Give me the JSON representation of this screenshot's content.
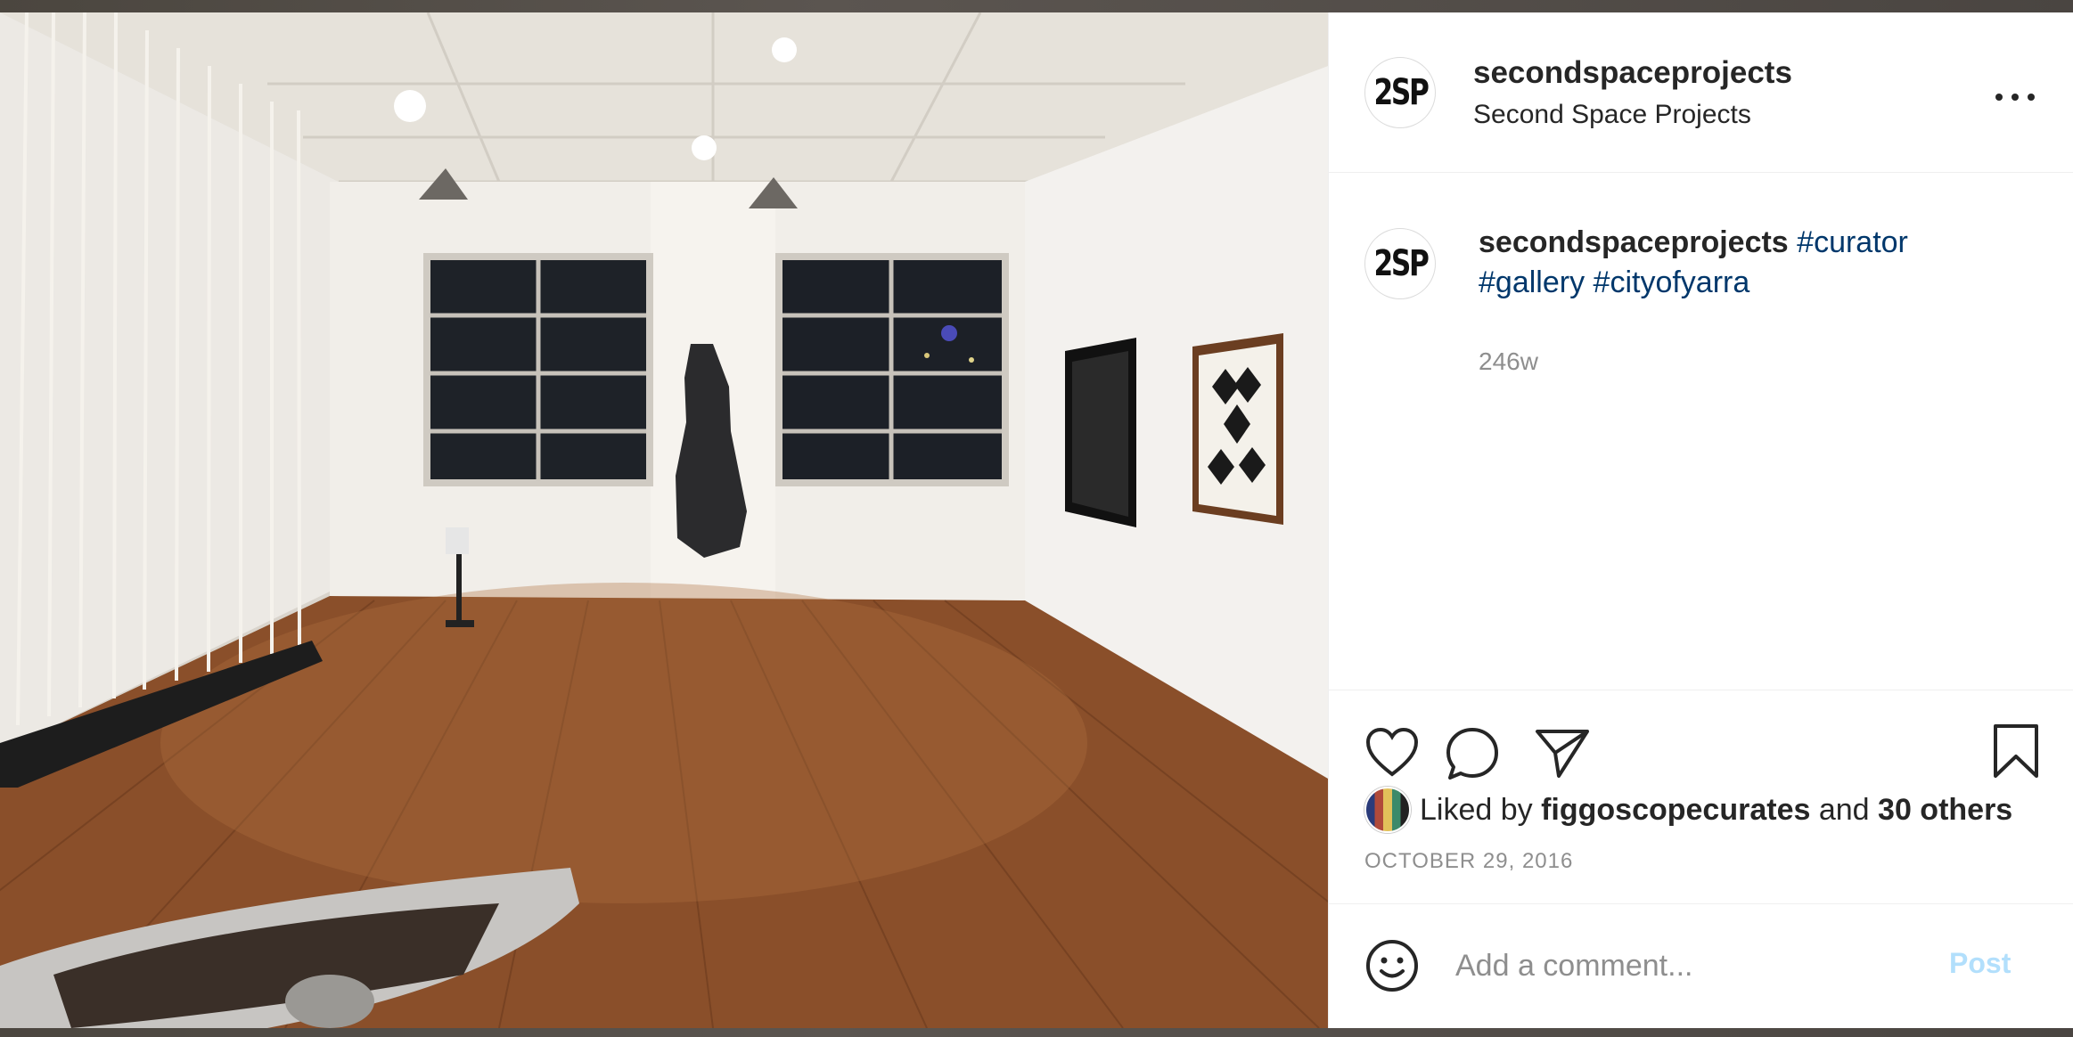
{
  "post": {
    "username": "secondspaceprojects",
    "full_name": "Second Space Projects",
    "avatar_text": "2SP",
    "more_icon": "more-horizontal-icon",
    "caption": {
      "username": "secondspaceprojects",
      "hashtags": [
        "#curator",
        "#gallery",
        "#cityofyarra"
      ]
    },
    "age": "246w",
    "likes": {
      "prefix": "Liked by",
      "user": "figgoscopecurates",
      "joiner": "and",
      "others": "30 others"
    },
    "date": "OCTOBER 29, 2016",
    "actions": {
      "icons": [
        "heart-icon",
        "comment-icon",
        "share-icon",
        "bookmark-icon"
      ]
    },
    "comment": {
      "placeholder": "Add a comment...",
      "post_label": "Post",
      "icon": "emoji-icon"
    }
  },
  "colors": {
    "text": "#262626",
    "secondary": "#8e8e8e",
    "hashtag": "#00376b",
    "post_disabled": "#b2dffc",
    "divider": "#efefef"
  }
}
